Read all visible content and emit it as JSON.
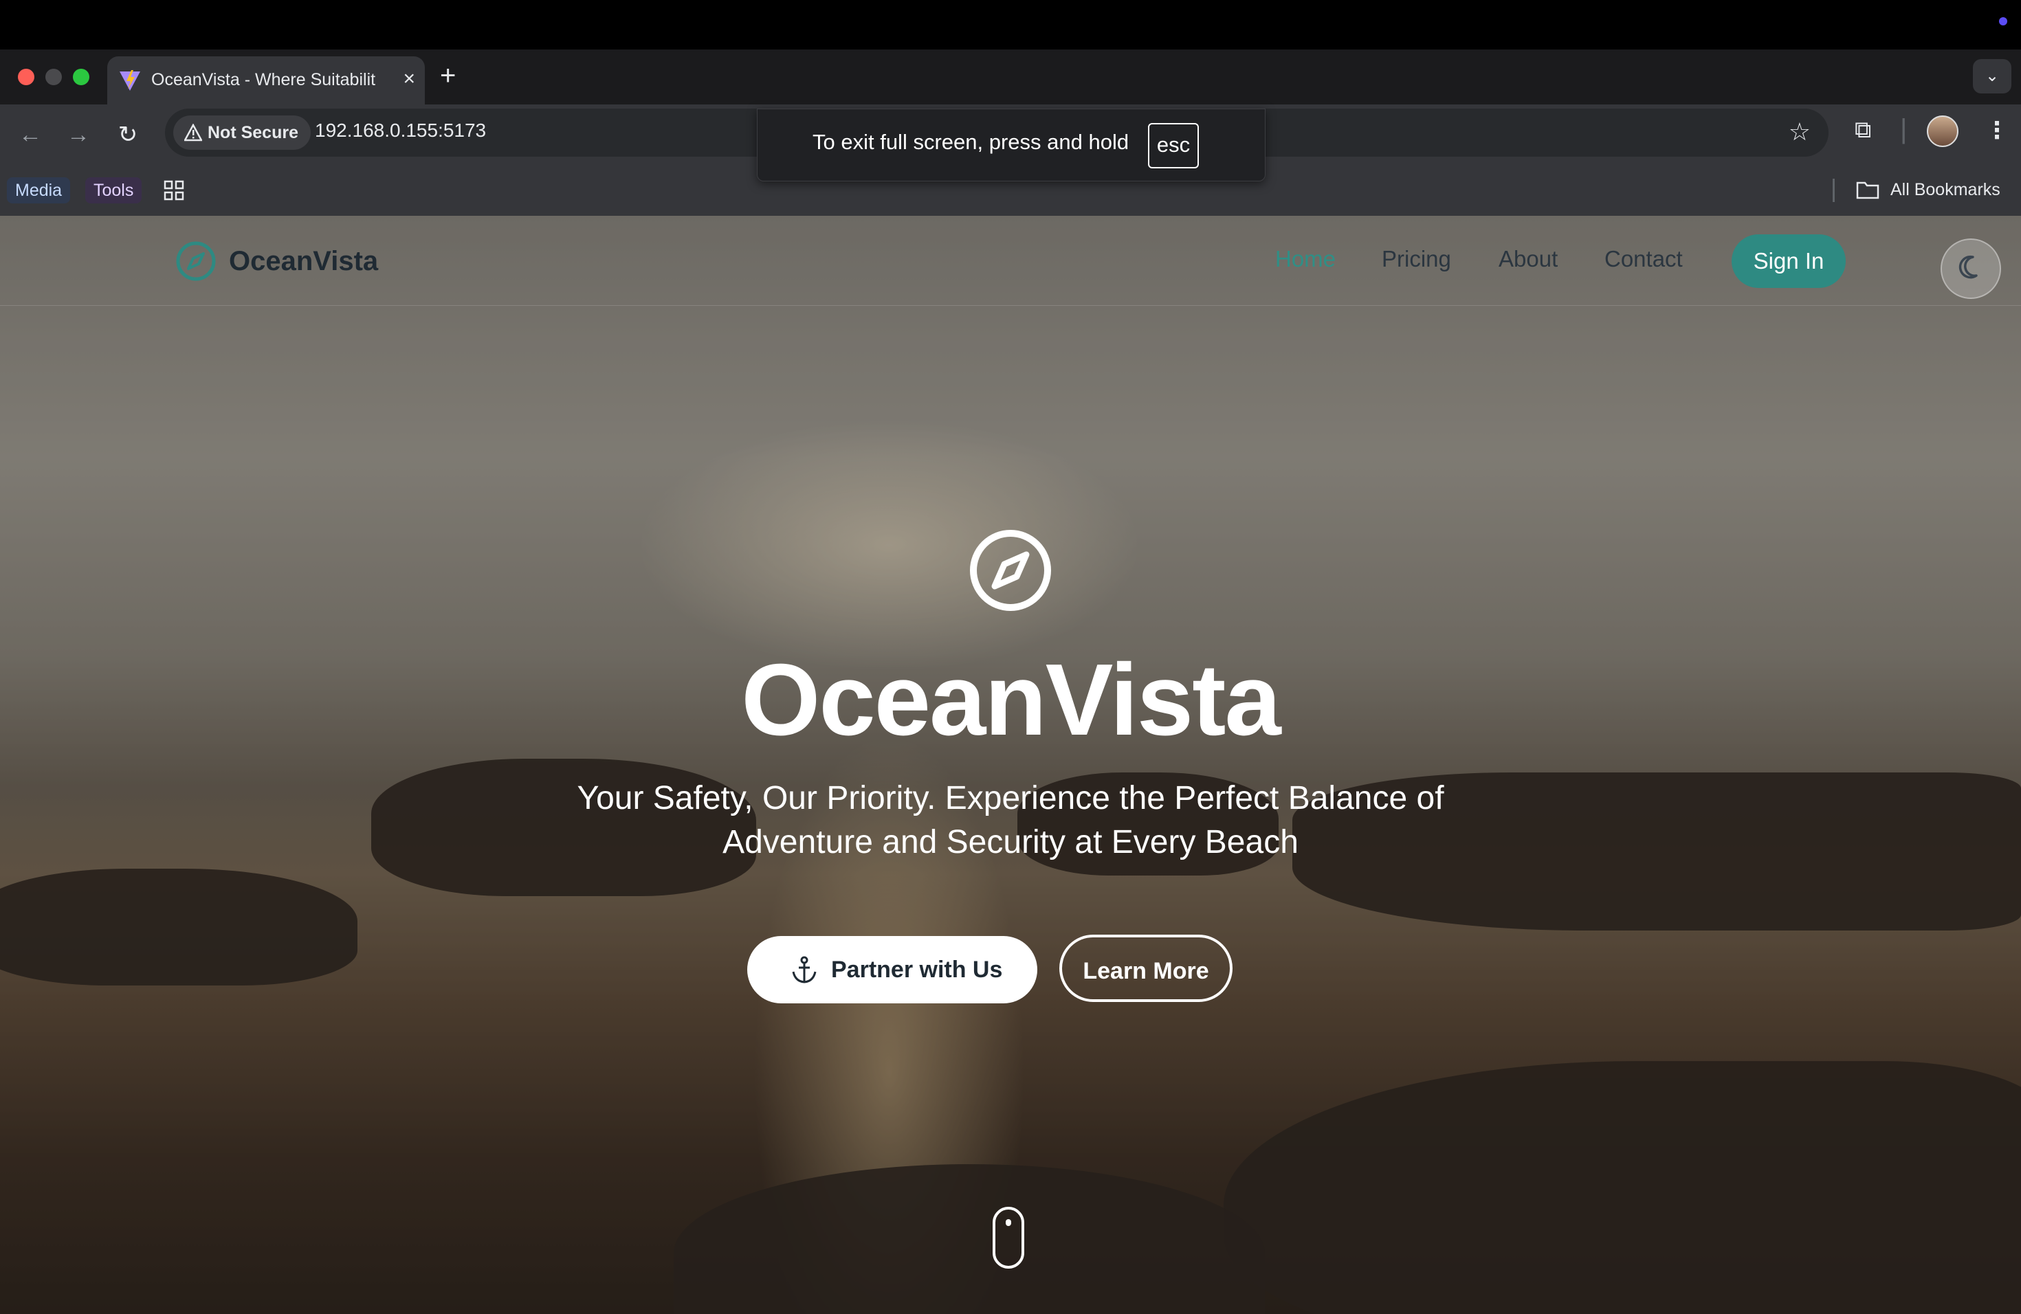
{
  "browser": {
    "tab": {
      "title": "OceanVista - Where Suitabilit"
    },
    "address": {
      "security_label": "Not Secure",
      "url": "192.168.0.155:5173"
    },
    "bookmarks": {
      "items": [
        "Media",
        "Tools"
      ],
      "all_label": "All Bookmarks"
    },
    "fullscreen_toast": {
      "message": "To exit full screen, press and hold",
      "key": "esc"
    }
  },
  "site": {
    "brand": "OceanVista",
    "nav": {
      "home": "Home",
      "pricing": "Pricing",
      "about": "About",
      "contact": "Contact",
      "signin": "Sign In"
    },
    "hero": {
      "title": "OceanVista",
      "subtitle": "Your Safety, Our Priority. Experience the Perfect Balance of Adventure and Security at Every Beach",
      "primary_cta": "Partner with Us",
      "secondary_cta": "Learn More"
    },
    "colors": {
      "accent": "#2e8a82",
      "active_link": "#2f8f86"
    },
    "icons": {
      "logo": "compass-icon",
      "cta": "anchor-icon",
      "theme": "moon-icon",
      "scroll": "mouse-scroll-icon"
    }
  }
}
